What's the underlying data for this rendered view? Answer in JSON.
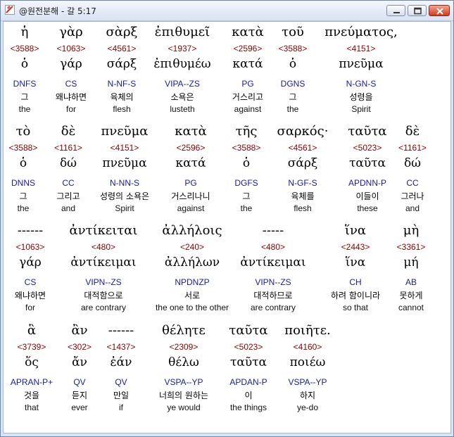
{
  "window": {
    "title": "@원전분해 - 갈 5:17",
    "buttons": {
      "minimize": "minimize-button",
      "maximize": "maximize-button",
      "close": "close-button"
    }
  },
  "colors": {
    "strong": "#8b0000",
    "morph": "#1a1aa8",
    "text": "#000000"
  },
  "rows": [
    {
      "units": [
        {
          "greek": "ἡ",
          "strong": "<3588>",
          "lemma": "ὁ",
          "morph": "DNFS",
          "korean": "그",
          "english": "the"
        },
        {
          "greek": "γὰρ",
          "strong": "<1063>",
          "lemma": "γάρ",
          "morph": "CS",
          "korean": "왜냐하면",
          "english": "for"
        },
        {
          "greek": "σὰρξ",
          "strong": "<4561>",
          "lemma": "σάρξ",
          "morph": "N-NF-S",
          "korean": "육체의",
          "english": "flesh"
        },
        {
          "greek": "ἐπιθυμεῖ",
          "strong": "<1937>",
          "lemma": "ἐπιθυμέω",
          "morph": "VIPA--ZS",
          "korean": "소욕은",
          "english": "lusteth"
        },
        {
          "greek": "κατὰ",
          "strong": "<2596>",
          "lemma": "κατά",
          "morph": "PG",
          "korean": "거스리고",
          "english": "against"
        },
        {
          "greek": "τοῦ",
          "strong": "<3588>",
          "lemma": "ὁ",
          "morph": "DGNS",
          "korean": "그",
          "english": "the"
        },
        {
          "greek": "πνεύματος,",
          "strong": "<4151>",
          "lemma": "πνεῦμα",
          "morph": "N-GN-S",
          "korean": "성령을",
          "english": "Spirit"
        }
      ]
    },
    {
      "units": [
        {
          "greek": "τὸ",
          "strong": "<3588>",
          "lemma": "ὁ",
          "morph": "DNNS",
          "korean": "그",
          "english": "the"
        },
        {
          "greek": "δὲ",
          "strong": "<1161>",
          "lemma": "δώ",
          "morph": "CC",
          "korean": "그리고",
          "english": "and"
        },
        {
          "greek": "πνεῦμα",
          "strong": "<4151>",
          "lemma": "πνεῦμα",
          "morph": "N-NN-S",
          "korean": "성령의 소욕은",
          "english": "Spirit"
        },
        {
          "greek": "κατὰ",
          "strong": "<2596>",
          "lemma": "κατά",
          "morph": "PG",
          "korean": "거스리나니",
          "english": "against"
        },
        {
          "greek": "τῆς",
          "strong": "<3588>",
          "lemma": "ὁ",
          "morph": "DGFS",
          "korean": "그",
          "english": "the"
        },
        {
          "greek": "σαρκός·",
          "strong": "<4561>",
          "lemma": "σάρξ",
          "morph": "N-GF-S",
          "korean": "육체를",
          "english": "flesh"
        },
        {
          "greek": "ταῦτα",
          "strong": "<5023>",
          "lemma": "ταῦτα",
          "morph": "APDNN-P",
          "korean": "이들이",
          "english": "these"
        },
        {
          "greek": "δὲ",
          "strong": "<1161>",
          "lemma": "δώ",
          "morph": "CC",
          "korean": "그러나",
          "english": "and"
        }
      ]
    },
    {
      "units": [
        {
          "greek": "------",
          "strong": "<1063>",
          "lemma": "γάρ",
          "morph": "CS",
          "korean": "왜냐하면",
          "english": "for"
        },
        {
          "greek": "ἀντίκειται",
          "strong": "<480>",
          "lemma": "ἀντίκειμαι",
          "morph": "VIPN--ZS",
          "korean": "대적함으로",
          "english": "are contrary"
        },
        {
          "greek": "ἀλλήλοις",
          "strong": "<240>",
          "lemma": "ἀλλήλων",
          "morph": "NPDNZP",
          "korean": "서로",
          "english": "the one to the other"
        },
        {
          "greek": "-----",
          "strong": "<480>",
          "lemma": "ἀντίκειμαι",
          "morph": "VIPN--ZS",
          "korean": "대적하므로",
          "english": "are contrary"
        },
        {
          "greek": "ἵνα",
          "strong": "<2443>",
          "lemma": "ἵνα",
          "morph": "CH",
          "korean": "하려 함이니라",
          "english": "so that"
        },
        {
          "greek": "μὴ",
          "strong": "<3361>",
          "lemma": "μή",
          "morph": "AB",
          "korean": "못하게",
          "english": "cannot"
        }
      ]
    },
    {
      "units": [
        {
          "greek": "ἃ",
          "strong": "<3739>",
          "lemma": "ὅς",
          "morph": "APRAN-P+",
          "korean": "것을",
          "english": "that"
        },
        {
          "greek": "ἂν",
          "strong": "<302>",
          "lemma": "ἄν",
          "morph": "QV",
          "korean": "듣지",
          "english": "ever"
        },
        {
          "greek": "------",
          "strong": "<1437>",
          "lemma": "ἐάν",
          "morph": "QV",
          "korean": "만일",
          "english": "if"
        },
        {
          "greek": "θέλητε",
          "strong": "<2309>",
          "lemma": "θέλω",
          "morph": "VSPA--YP",
          "korean": "너희의 원하는",
          "english": "ye would"
        },
        {
          "greek": "ταῦτα",
          "strong": "<5023>",
          "lemma": "ταῦτα",
          "morph": "APDAN-P",
          "korean": "이",
          "english": "the things"
        },
        {
          "greek": "ποιῆτε.",
          "strong": "<4160>",
          "lemma": "ποιέω",
          "morph": "VSPA--YP",
          "korean": "하지",
          "english": "ye-do"
        }
      ]
    }
  ]
}
